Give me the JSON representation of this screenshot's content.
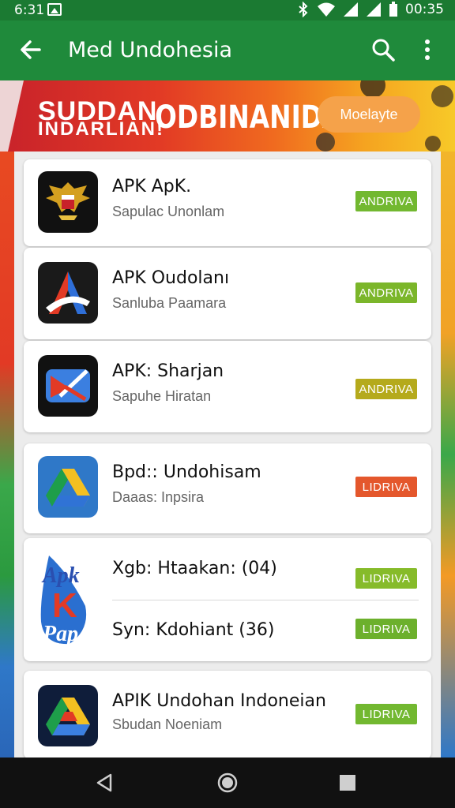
{
  "status_bar": {
    "time": "6:31",
    "clock": "00:35"
  },
  "app_bar": {
    "title": "Med Undohesia"
  },
  "banner": {
    "line1": "SUDDAN",
    "line2": "INDARLIAN!",
    "headline": "ODBINANIDA",
    "button_label": "Moelayte"
  },
  "apps": [
    {
      "title": "APK ApK.",
      "subtitle": "Sapulac Unonlam",
      "badge": "ANDRIVA",
      "badge_color": "#72b830",
      "icon": "garuda-icon"
    },
    {
      "title": "APK Oudolanı",
      "subtitle": "Sanluba Paamara",
      "badge": "ANDRIVA",
      "badge_color": "#7bb62a",
      "icon": "a-logo-icon"
    },
    {
      "title": "APK: Sharjan",
      "subtitle": "Sapuhe Hiratan",
      "badge": "ANDRIVA",
      "badge_color": "#b5aa1c",
      "icon": "x-logo-icon"
    },
    {
      "title": "Bpd:: Undohisam",
      "subtitle": "Daaas: Inpsira",
      "badge": "LIDRIVA",
      "badge_color": "#e4572c",
      "icon": "drive-icon"
    },
    {
      "icon": "apk-pap-logo-icon",
      "rows": [
        {
          "title": "Xgb: Htaakan: (04)",
          "badge": "LIDRIVA",
          "badge_color": "#86bb2a"
        },
        {
          "title": "Syn: Kdohiant (36)",
          "badge": "LIDRIVA",
          "badge_color": "#6cb02c"
        }
      ]
    },
    {
      "title": "APIK Undohan Indoneian",
      "subtitle": "Sbudan Noeniam",
      "badge": "LIDRIVA",
      "badge_color": "#72b830",
      "icon": "drive-dark-icon"
    }
  ]
}
